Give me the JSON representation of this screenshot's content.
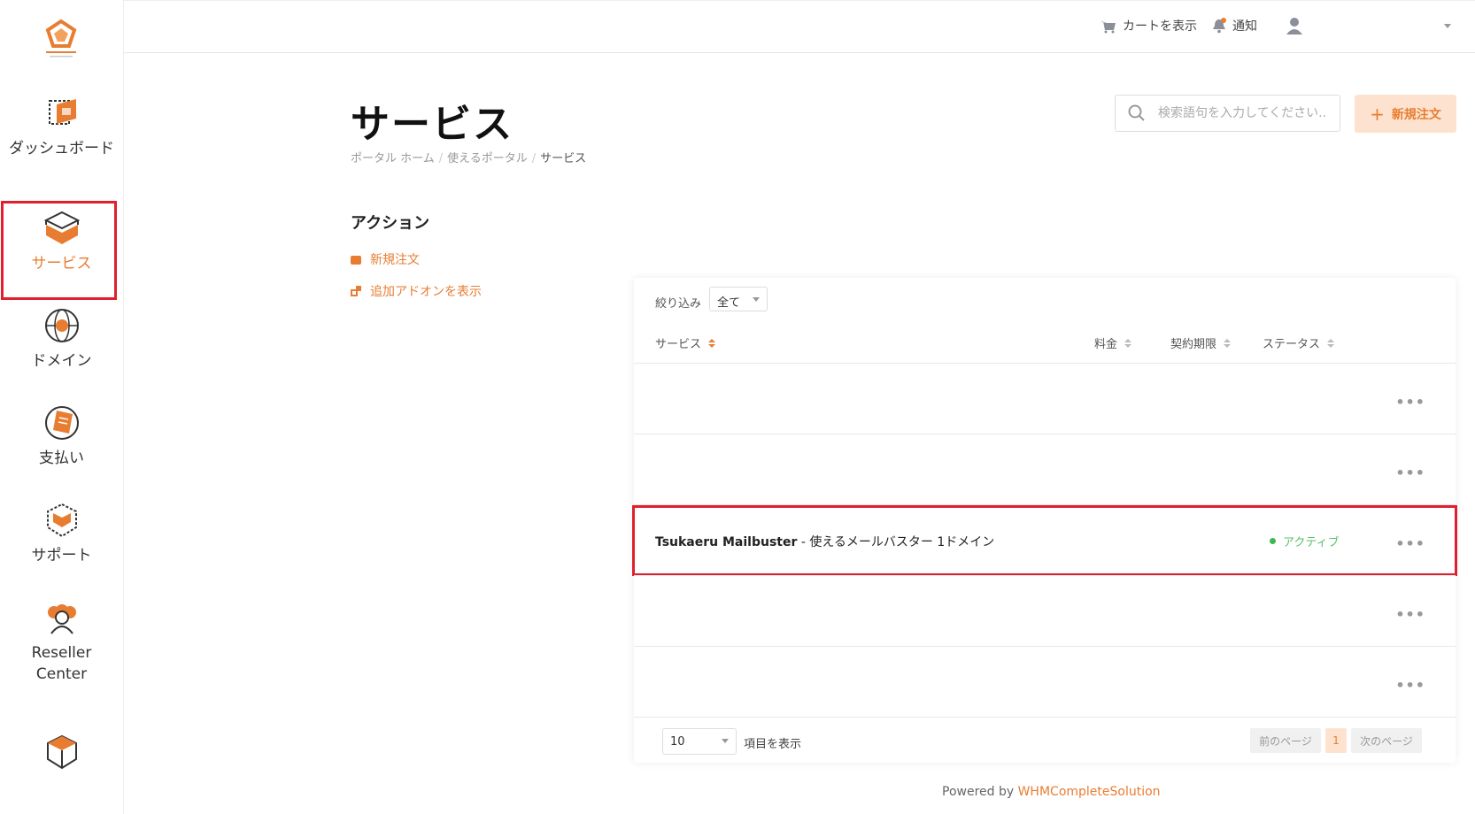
{
  "topbar": {
    "cart": "カートを表示",
    "notifications": "通知"
  },
  "sidebar": {
    "items": [
      {
        "label": "ダッシュボード"
      },
      {
        "label": "サービス"
      },
      {
        "label": "ドメイン"
      },
      {
        "label": "支払い"
      },
      {
        "label": "サポート"
      },
      {
        "label": "Reseller Center"
      }
    ]
  },
  "header": {
    "title": "サービス",
    "breadcrumb": [
      "ポータル ホーム",
      "使えるポータル",
      "サービス"
    ]
  },
  "search": {
    "placeholder": "検索語句を入力してください..."
  },
  "new_order_button": "新規注文",
  "actions": {
    "title": "アクション",
    "items": [
      "新規注文",
      "追加アドオンを表示"
    ]
  },
  "table": {
    "filter_label": "絞り込み",
    "filter_value": "全て",
    "columns": [
      "サービス",
      "料金",
      "契約期限",
      "ステータス"
    ],
    "rows": [
      {
        "name": "",
        "desc": "",
        "status": ""
      },
      {
        "name": "",
        "desc": "",
        "status": ""
      },
      {
        "name": "Tsukaeru Mailbuster",
        "desc": " - 使えるメールバスター 1ドメイン",
        "status": "アクティブ"
      },
      {
        "name": "",
        "desc": "",
        "status": ""
      },
      {
        "name": "",
        "desc": "",
        "status": ""
      }
    ],
    "page_length": "10",
    "page_length_label": "項目を表示",
    "prev": "前のページ",
    "page": "1",
    "next": "次のページ"
  },
  "footer": {
    "powered": "Powered by ",
    "brand": "WHMCompleteSolution"
  },
  "colors": {
    "accent": "#e87d32",
    "highlight": "#e0202c",
    "active_status": "#3cb950"
  }
}
